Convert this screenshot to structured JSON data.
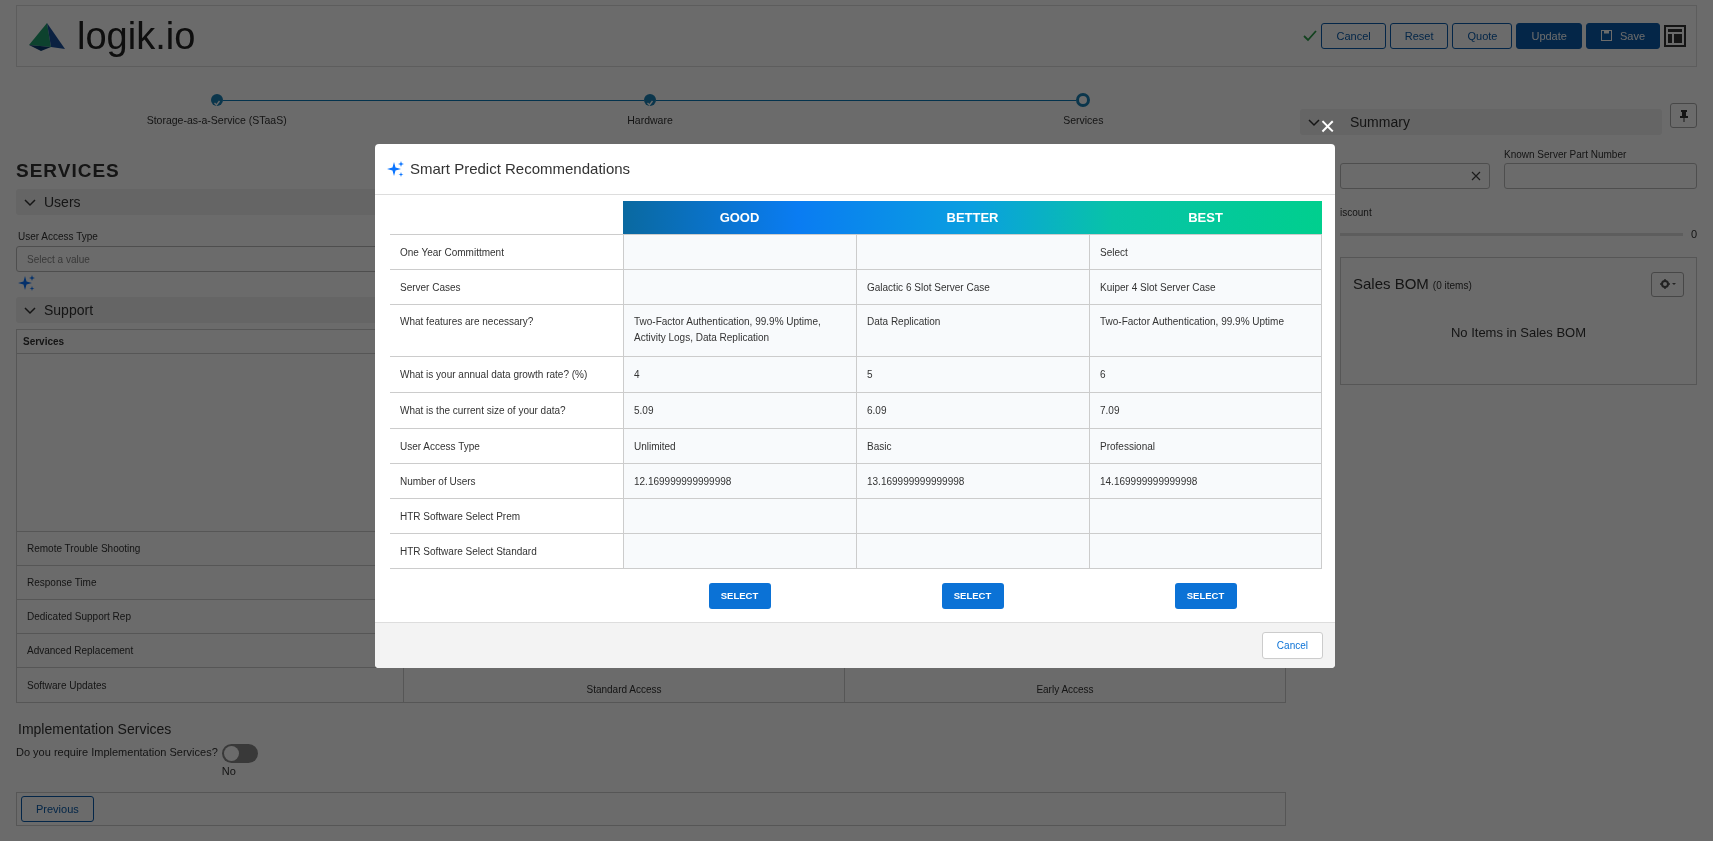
{
  "header": {
    "logo": "logik.io",
    "buttons": [
      {
        "label": "Cancel",
        "kind": "outline"
      },
      {
        "label": "Reset",
        "kind": "outline"
      },
      {
        "label": "Quote",
        "kind": "outline"
      },
      {
        "label": "Update",
        "kind": "primary"
      },
      {
        "label": "Save",
        "kind": "save"
      }
    ]
  },
  "stepper": [
    {
      "label": "Storage-as-a-Service (STaaS)",
      "completed": true
    },
    {
      "label": "Hardware",
      "completed": true
    },
    {
      "label": "Services",
      "completed": false
    }
  ],
  "page_title": "SERVICES",
  "users": {
    "title": "Users",
    "expanded": true,
    "field_label": "User Access Type",
    "placeholder": "Select a value"
  },
  "support": {
    "title": "Support",
    "expanded": true,
    "table_header": "Services",
    "rows": [
      {
        "label": "Remote Trouble Shooting"
      },
      {
        "label": "Response Time"
      },
      {
        "label": "Dedicated Support Rep"
      },
      {
        "label": "Advanced Replacement"
      },
      {
        "label": "Software Updates",
        "cells": [
          "Standard Access",
          "Early Access"
        ]
      }
    ]
  },
  "implementation": {
    "title": "Implementation Services",
    "question": "Do you require Implementation Services?",
    "on": false,
    "state_label": "No"
  },
  "previous_button": "Previous",
  "summary": {
    "title": "Summary",
    "expanded": true,
    "part_number_label": "Known Server Part Number",
    "discount_label": "iscount",
    "discount": {
      "level": 0,
      "reading": "0"
    },
    "bom_title": "Sales BOM",
    "bom_count": "(0 items)",
    "bom_empty": "No Items in Sales BOM"
  },
  "modal": {
    "close_label": "×",
    "title": "Smart Predict Recommendations",
    "columns": [
      "GOOD",
      "BETTER",
      "BEST"
    ],
    "rows": [
      {
        "label": "One Year Committment",
        "cells": [
          {},
          {},
          {
            "text": "Select"
          }
        ]
      },
      {
        "label": "Server Cases",
        "cells": [
          {},
          {
            "text": "Galactic 6 Slot Server Case"
          },
          {
            "text": "Kuiper 4 Slot Server Case"
          }
        ]
      },
      {
        "label": "What features are necessary?",
        "cells": [
          {
            "text": "Two-Factor Authentication, 99.9% Uptime, Activity Logs, Data Replication"
          },
          {
            "text": "Data Replication"
          },
          {
            "text": "Two-Factor Authentication, 99.9% Uptime"
          }
        ]
      },
      {
        "label": "What is your annual data growth rate? (%)",
        "cells": [
          {
            "text": "4"
          },
          {
            "text": "5"
          },
          {
            "text": "6"
          }
        ]
      },
      {
        "label": "What is the current size of your data?",
        "cells": [
          {
            "text": "5.09"
          },
          {
            "text": "6.09"
          },
          {
            "text": "7.09"
          }
        ]
      },
      {
        "label": "User Access Type",
        "cells": [
          {
            "text": "Unlimited"
          },
          {
            "text": "Basic"
          },
          {
            "text": "Professional"
          }
        ]
      },
      {
        "label": "Number of Users",
        "cells": [
          {
            "text": "12.169999999999998"
          },
          {
            "text": "13.169999999999998"
          },
          {
            "text": "14.169999999999998"
          }
        ]
      },
      {
        "label": "HTR Software Select Prem",
        "cells": [
          {},
          {},
          {}
        ]
      },
      {
        "label": "HTR Software Select Standard",
        "cells": [
          {},
          {},
          {}
        ]
      }
    ],
    "select_buttons": [
      "SELECT",
      "SELECT",
      "SELECT"
    ],
    "cancel": "Cancel"
  }
}
